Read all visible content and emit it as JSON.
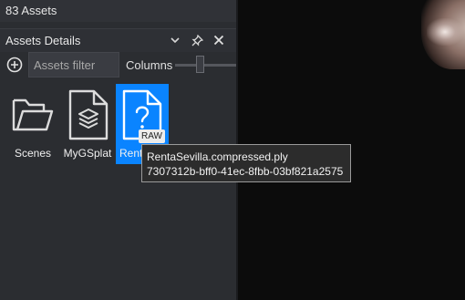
{
  "header": {
    "asset_count": "83 Assets"
  },
  "panel": {
    "title": "Assets Details",
    "icons": [
      "chevron-down-icon",
      "pin-icon",
      "close-icon"
    ]
  },
  "toolbar": {
    "filter_placeholder": "Assets filter",
    "filter_value": "",
    "columns_label": "Columns",
    "columns_slider_level": 0.4
  },
  "assets": [
    {
      "name": "Scenes",
      "icon": "folder-icon",
      "selected": false
    },
    {
      "name": "MyGSplat",
      "icon": "stack-file-icon",
      "selected": false
    },
    {
      "name": "Rent",
      "icon": "unknown-file-icon",
      "selected": true,
      "badge": "RAW"
    }
  ],
  "tooltip": {
    "filename": "RentaSevilla.compressed.ply",
    "id": "7307312b-bff0-41ec-8fbb-03bf821a2575"
  },
  "colors": {
    "panel_bg": "#2b2d31",
    "selection": "#0a84ff",
    "viewport_bg": "#0c0c0c"
  }
}
